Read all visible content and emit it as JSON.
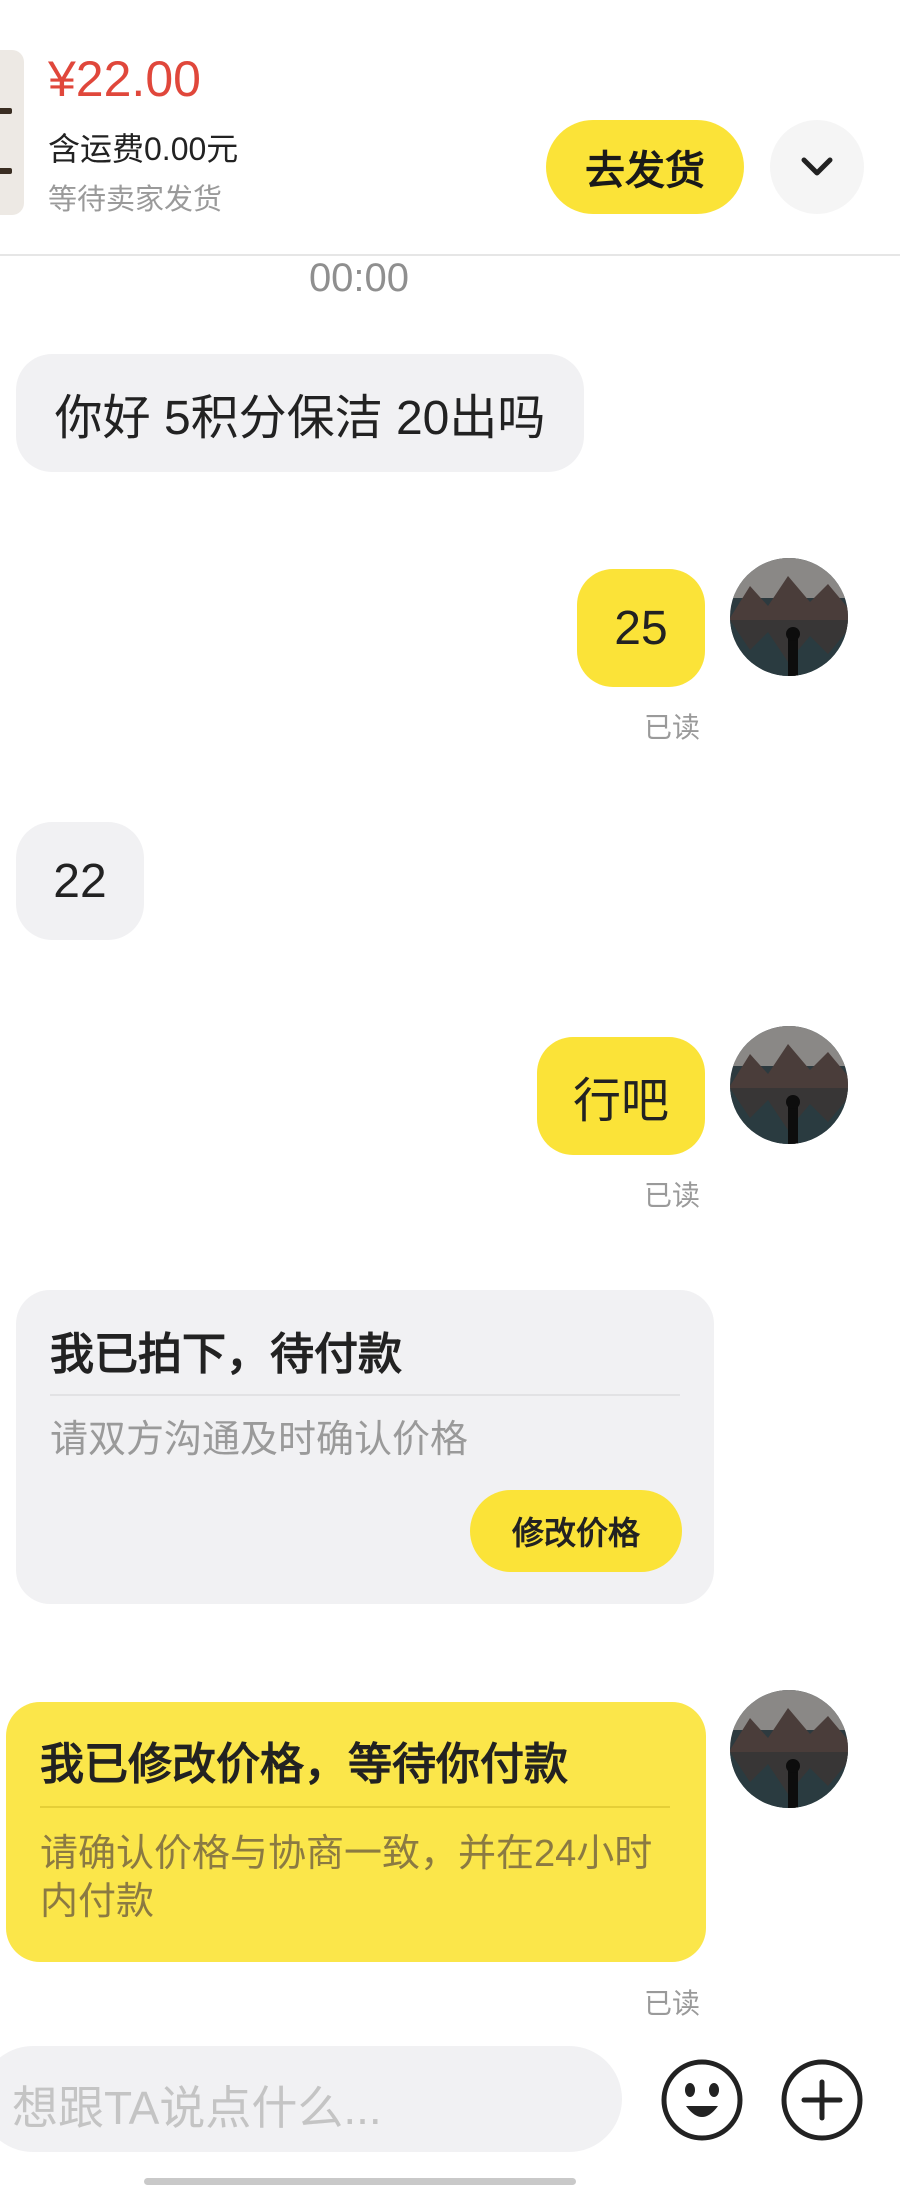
{
  "header": {
    "price": "¥22.00",
    "shipping": "含运费0.00元",
    "status": "等待卖家发货",
    "ship_button": "去发货",
    "dropdown_icon": "chevron-down-icon"
  },
  "chat": {
    "timestamp": "00:00",
    "messages": [
      {
        "side": "left",
        "text": "你好 5积分保洁 20出吗"
      },
      {
        "side": "right",
        "text": "25",
        "read": "已读"
      },
      {
        "side": "left",
        "text": "22"
      },
      {
        "side": "right",
        "text": "行吧",
        "read": "已读"
      }
    ],
    "order_card": {
      "title": "我已拍下，待付款",
      "desc": "请双方沟通及时确认价格",
      "button": "修改价格"
    },
    "price_card": {
      "title": "我已修改价格，等待你付款",
      "desc": "请确认价格与协商一致，并在24小时内付款",
      "read": "已读"
    }
  },
  "input": {
    "placeholder": "想跟TA说点什么...",
    "emoji_icon": "emoji-icon",
    "add_icon": "plus-circle-icon"
  },
  "colors": {
    "accent_yellow": "#fbe338",
    "price_red": "#e0473b"
  }
}
